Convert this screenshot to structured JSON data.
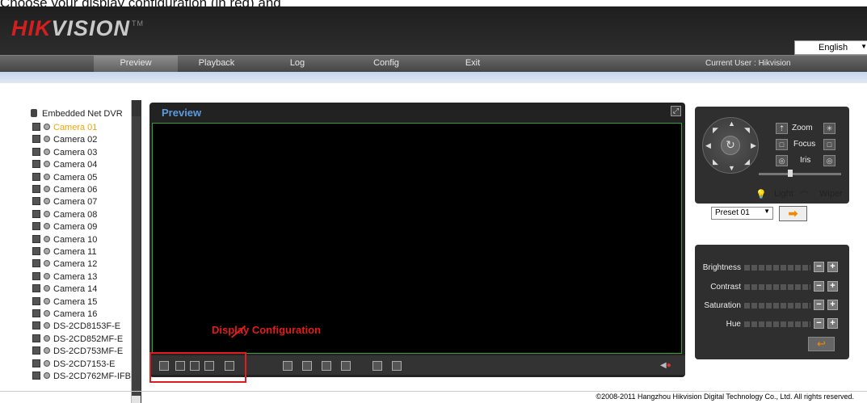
{
  "caption": "Choose your display configuration (in red) and",
  "header": {
    "logo_hik": "HIK",
    "logo_vision": "VISION",
    "logo_tm": "TM",
    "language": "English"
  },
  "nav": {
    "items": [
      "Preview",
      "Playback",
      "Log",
      "Config",
      "Exit"
    ],
    "active": "Preview",
    "current_user": "Current User : Hikvision"
  },
  "tree": {
    "root": "Embedded Net DVR",
    "cameras": [
      "Camera 01",
      "Camera 02",
      "Camera 03",
      "Camera 04",
      "Camera 05",
      "Camera 06",
      "Camera 07",
      "Camera 08",
      "Camera 09",
      "Camera 10",
      "Camera 11",
      "Camera 12",
      "Camera 13",
      "Camera 14",
      "Camera 15",
      "Camera 16",
      "DS-2CD8153F-E",
      "DS-2CD852MF-E",
      "DS-2CD753MF-E",
      "DS-2CD7153-E",
      "DS-2CD762MF-IFB"
    ],
    "selected": "Camera 01"
  },
  "preview": {
    "title": "Preview"
  },
  "annotation": {
    "label": "Display Configuration"
  },
  "ptz": {
    "zoom": "Zoom",
    "focus": "Focus",
    "iris": "Iris",
    "light": "Light",
    "wiper": "Wiper",
    "preset": "Preset 01"
  },
  "image_settings": {
    "labels": [
      "Brightness",
      "Contrast",
      "Saturation",
      "Hue"
    ]
  },
  "footer": {
    "copyright": "©2008-2011 Hangzhou Hikvision Digital Technology Co., Ltd. All rights reserved."
  }
}
